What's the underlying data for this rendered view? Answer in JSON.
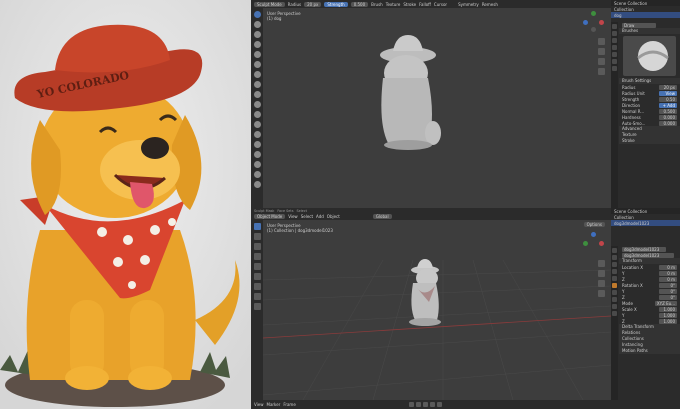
{
  "reference": {
    "hat_text": "YO COLORADO"
  },
  "sculpt": {
    "mode": "Sculpt Mode",
    "radius_label": "Radius",
    "radius_value": "20 px",
    "strength_label": "Strength",
    "strength_value": "0.500",
    "menus": [
      "Brush",
      "Texture",
      "Stroke",
      "Falloff",
      "Cursor"
    ],
    "symmetry": "Symmetry",
    "remesh": "Remesh",
    "view_name": "User Perspective",
    "object_name": "(1) dog"
  },
  "sculpt_props": {
    "collection": "Scene Collection",
    "collection2": "Collection",
    "object": "dog",
    "brush_name": "Draw",
    "brushes_title": "Brushes",
    "brush_settings_title": "Brush Settings",
    "radius_label": "Radius",
    "radius_value": "20 px",
    "radius_unit_label": "Radius Unit",
    "radius_unit_value": "View",
    "strength_label": "Strength",
    "strength_value": "0.50",
    "direction_label": "Direction",
    "direction_value": "+ Add",
    "normal_label": "Normal R...",
    "normal_value": "0.500",
    "hardness_label": "Hardness",
    "hardness_value": "0.000",
    "autosmooth_label": "Auto-Smo...",
    "autosmooth_value": "0.000",
    "advanced": "Advanced",
    "texture": "Texture",
    "stroke": "Stroke"
  },
  "object": {
    "mode": "Object Mode",
    "menus": [
      "View",
      "Select",
      "Add",
      "Object"
    ],
    "global": "Global",
    "options": "Options",
    "view_name": "User Perspective",
    "object_name": "(1) Collection | dog3dmodel1023",
    "menus_header_top": [
      "Sculpt Mask",
      "Face Sets",
      "Select"
    ]
  },
  "outliner": {
    "scene": "Scene Collection",
    "collection": "Collection",
    "item": "dog3dmodel1023"
  },
  "obj_props": {
    "search_name": "dog3dmodel1023",
    "object_name": "dog3dmodel1023",
    "transform": "Transform",
    "location_x_label": "Location X",
    "location_x": "0 m",
    "location_y_label": "Y",
    "location_y": "0 m",
    "location_z_label": "Z",
    "location_z": "0 m",
    "rotation_x_label": "Rotation X",
    "rotation_x": "0°",
    "rotation_y_label": "Y",
    "rotation_y": "0°",
    "rotation_z_label": "Z",
    "rotation_z": "0°",
    "mode_label": "Mode",
    "mode_value": "XYZ Eu...",
    "scale_x_label": "Scale X",
    "scale_x": "1.000",
    "scale_y_label": "Y",
    "scale_y": "1.000",
    "scale_z_label": "Z",
    "scale_z": "1.000",
    "delta": "Delta Transform",
    "relations": "Relations",
    "collections": "Collections",
    "instancing": "Instancing",
    "motion_paths": "Motion Paths"
  },
  "bottom_bar": {
    "items": [
      "View",
      "Marker",
      "Frame"
    ]
  },
  "colors": {
    "accent": "#4772b3",
    "viewport": "#3d3d3d",
    "panel": "#2b2b2b",
    "hat": "#c8452a",
    "dog": "#e8a22a",
    "bandana": "#d9452f"
  }
}
